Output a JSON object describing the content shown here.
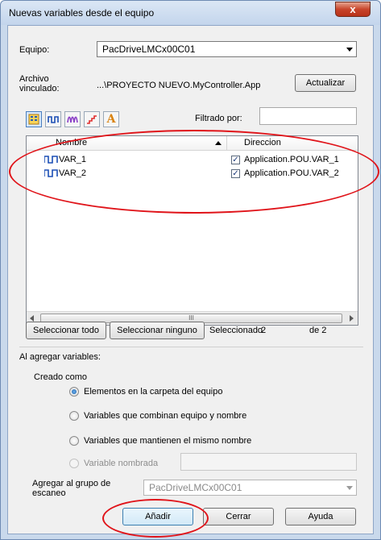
{
  "window": {
    "title": "Nuevas variables desde el equipo",
    "close_label": "x"
  },
  "equipo": {
    "label": "Equipo:",
    "value": "PacDriveLMCx00C01"
  },
  "archivo": {
    "label_line1": "Archivo",
    "label_line2": "vinculado:",
    "value": "...\\PROYECTO NUEVO.MyController.App",
    "refresh_button": "Actualizar"
  },
  "toolbar": {
    "icons": [
      "all-variables-icon",
      "digital-signal-icon",
      "analog-signal-icon",
      "ramp-signal-icon",
      "text-icon"
    ],
    "text_icon_glyph": "A",
    "filter_label": "Filtrado por:",
    "filter_value": ""
  },
  "table": {
    "columns": [
      "Nombre",
      "Direccion"
    ],
    "rows": [
      {
        "name": "VAR_1",
        "checked": true,
        "address": "Application.POU.VAR_1"
      },
      {
        "name": "VAR_2",
        "checked": true,
        "address": "Application.POU.VAR_2"
      }
    ],
    "scroll_grip": "III"
  },
  "selection": {
    "select_all": "Seleccionar todo",
    "select_none": "Seleccionar ninguno",
    "selected_label": "Seleccionado",
    "selected_count": "2",
    "total_label": "de 2"
  },
  "options": {
    "section_label": "Al agregar variables:",
    "created_as_label": "Creado como",
    "radios": [
      {
        "label": "Elementos en la carpeta del equipo",
        "checked": true,
        "enabled": true
      },
      {
        "label": "Variables que combinan equipo y nombre",
        "checked": false,
        "enabled": true
      },
      {
        "label": "Variables que mantienen el mismo nombre",
        "checked": false,
        "enabled": true
      },
      {
        "label": "Variable nombrada",
        "checked": false,
        "enabled": false
      }
    ],
    "named_variable_value": "",
    "scan_group_label_line1": "Agregar al grupo de",
    "scan_group_label_line2": "escaneo",
    "scan_group_value": "PacDriveLMCx00C01"
  },
  "footer": {
    "add": "Añadir",
    "close": "Cerrar",
    "help": "Ayuda"
  },
  "colors": {
    "annotation": "#e0141a",
    "accent": "#1d5fa8"
  }
}
